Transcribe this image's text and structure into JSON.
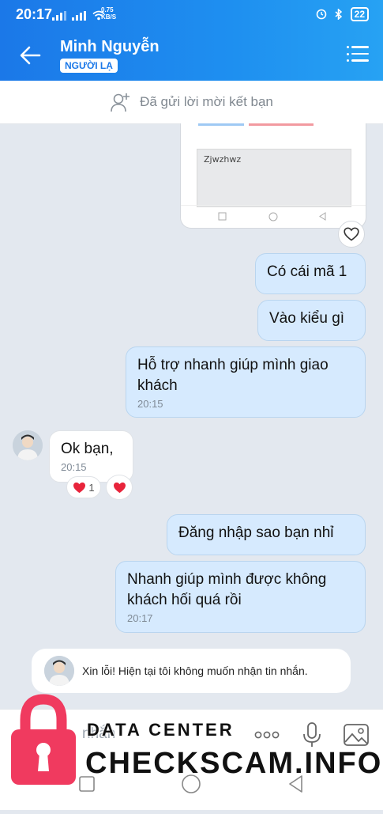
{
  "status_bar": {
    "time": "20:17",
    "net_speed_value": "0.75",
    "net_speed_unit": "KB/S",
    "battery": "22"
  },
  "header": {
    "contact_name": "Minh Nguyễn",
    "badge": "NGƯỜI LẠ"
  },
  "friend_request": {
    "label": "Đã gửi lời mời kết bạn"
  },
  "shared_image": {
    "text": "Zjwzhwz"
  },
  "messages": [
    {
      "sender": "me",
      "text": "Có cái mã 1"
    },
    {
      "sender": "me",
      "text": "Vào kiểu gì"
    },
    {
      "sender": "me",
      "text": "Hỗ trợ nhanh giúp mình giao khách",
      "time": "20:15"
    },
    {
      "sender": "them",
      "text": "Ok bạn,",
      "time": "20:15"
    },
    {
      "sender": "me",
      "text": "Đăng nhập sao bạn nhỉ"
    },
    {
      "sender": "me",
      "text": "Nhanh giúp mình được không khách hối quá rồi",
      "time": "20:17"
    }
  ],
  "reactions": {
    "count": "1",
    "emoji": "heart"
  },
  "notice": {
    "text": "Xin lỗi! Hiện tại tôi không muốn nhận tin nhắn."
  },
  "composer": {
    "placeholder_fragment": "nhắn"
  },
  "watermark": {
    "line1": "DATA CENTER",
    "line2": "CHECKSCAM.INFO"
  },
  "colors": {
    "header_blue": "#1b78e8",
    "my_bubble": "#d6eafe",
    "heart_red": "#e8243b",
    "lock_red": "#f03a5f"
  }
}
